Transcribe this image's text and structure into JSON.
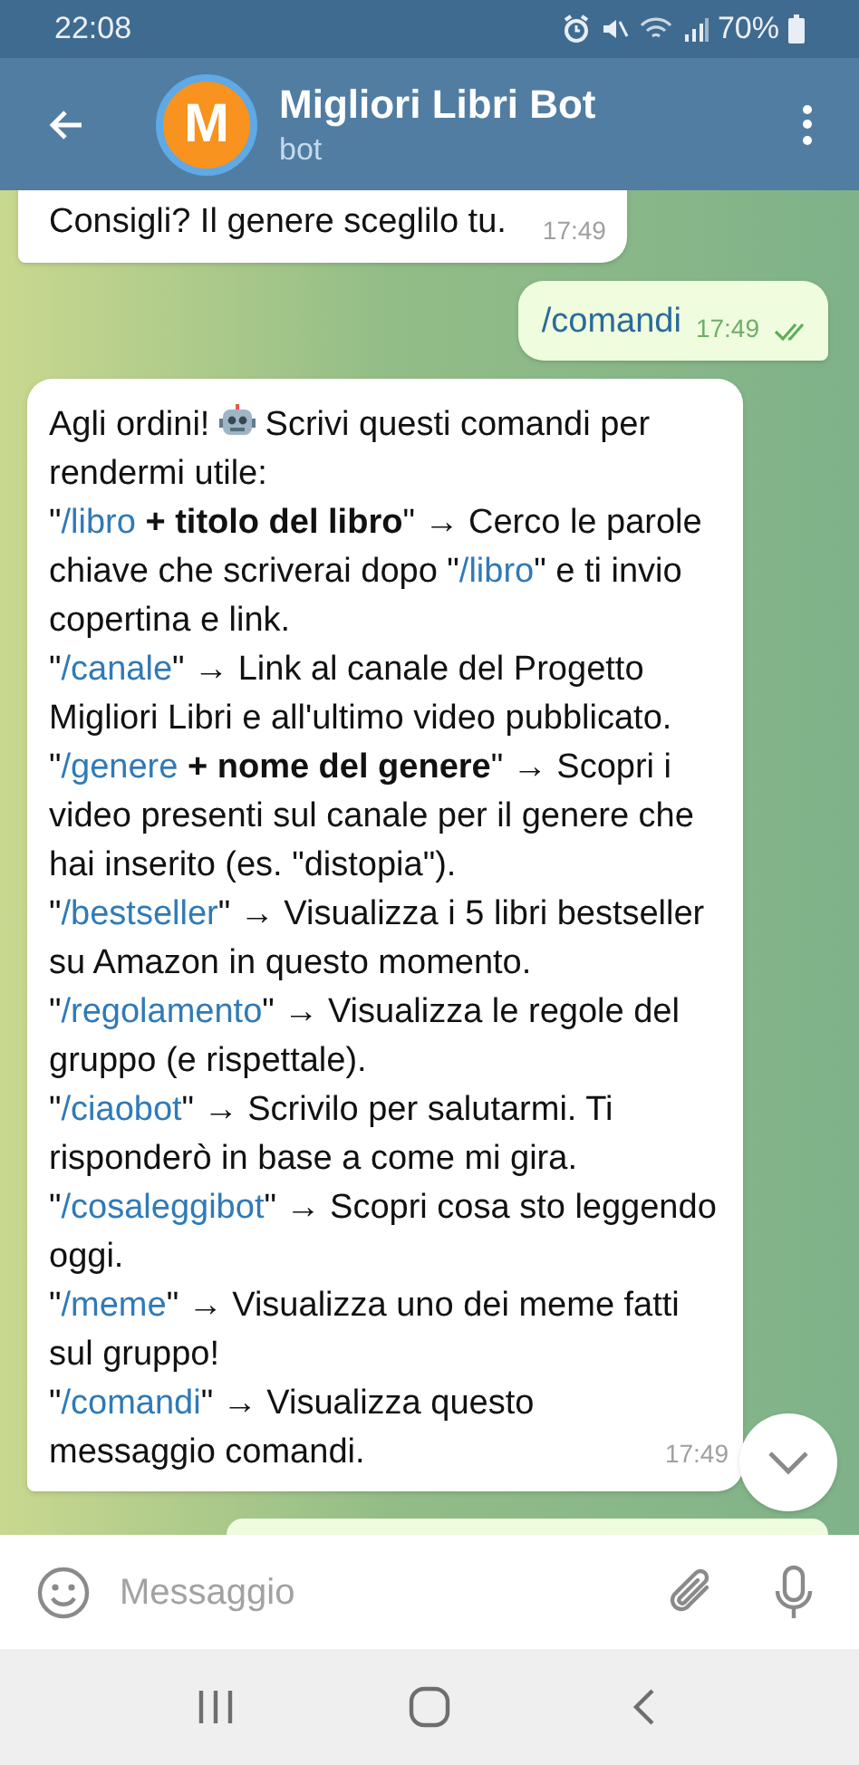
{
  "status_bar": {
    "time": "22:08",
    "battery": "70%"
  },
  "header": {
    "title": "Migliori Libri Bot",
    "subtitle": "bot",
    "avatar_letter": "M"
  },
  "messages": [
    {
      "kind": "incoming",
      "text": "Consigli? Il genere sceglilo tu.",
      "time": "17:49"
    },
    {
      "kind": "outgoing",
      "text": "/comandi",
      "time": "17:49",
      "read": true
    },
    {
      "kind": "incoming_rich",
      "time": "17:49",
      "paragraphs": [
        [
          {
            "kind": "text",
            "text": "Agli ordini! "
          },
          {
            "kind": "robot"
          },
          {
            "kind": "text",
            "text": " Scrivi questi comandi per rendermi utile:"
          }
        ],
        [
          {
            "kind": "text",
            "text": "\""
          },
          {
            "kind": "command",
            "text": "/libro"
          },
          {
            "kind": "bold",
            "text": " + titolo del libro"
          },
          {
            "kind": "text",
            "text": "\" → Cerco le parole chiave che scriverai dopo \""
          },
          {
            "kind": "command",
            "text": "/libro"
          },
          {
            "kind": "text",
            "text": "\" e ti invio copertina e link."
          }
        ],
        [
          {
            "kind": "text",
            "text": "\""
          },
          {
            "kind": "command",
            "text": "/canale"
          },
          {
            "kind": "text",
            "text": "\" → Link al canale del Progetto Migliori Libri e all'ultimo video pubblicato."
          }
        ],
        [
          {
            "kind": "text",
            "text": "\""
          },
          {
            "kind": "command",
            "text": "/genere"
          },
          {
            "kind": "bold",
            "text": " + nome del genere"
          },
          {
            "kind": "text",
            "text": "\" → Scopri i video presenti sul canale per il genere che hai inserito (es. \"distopia\")."
          }
        ],
        [
          {
            "kind": "text",
            "text": "\""
          },
          {
            "kind": "command",
            "text": "/bestseller"
          },
          {
            "kind": "text",
            "text": "\" → Visualizza i 5 libri bestseller su Amazon in questo momento."
          }
        ],
        [
          {
            "kind": "text",
            "text": "\""
          },
          {
            "kind": "command",
            "text": "/regolamento"
          },
          {
            "kind": "text",
            "text": "\" → Visualizza le regole del gruppo (e rispettale)."
          }
        ],
        [
          {
            "kind": "text",
            "text": "\""
          },
          {
            "kind": "command",
            "text": "/ciaobot"
          },
          {
            "kind": "text",
            "text": "\" → Scrivilo per salutarmi. Ti risponderò in base a come mi gira."
          }
        ],
        [
          {
            "kind": "text",
            "text": "\""
          },
          {
            "kind": "command",
            "text": "/cosaleggibot"
          },
          {
            "kind": "text",
            "text": "\" → Scopri cosa sto leggendo oggi."
          }
        ],
        [
          {
            "kind": "text",
            "text": "\""
          },
          {
            "kind": "command",
            "text": "/meme"
          },
          {
            "kind": "text",
            "text": "\" → Visualizza uno dei meme fatti sul gruppo!"
          }
        ],
        [
          {
            "kind": "text",
            "text": "\""
          },
          {
            "kind": "command",
            "text": "/comandi"
          },
          {
            "kind": "text",
            "text": "\" → Visualizza questo messaggio comandi."
          }
        ]
      ]
    },
    {
      "kind": "outgoing_partial"
    }
  ],
  "input": {
    "placeholder": "Messaggio"
  }
}
